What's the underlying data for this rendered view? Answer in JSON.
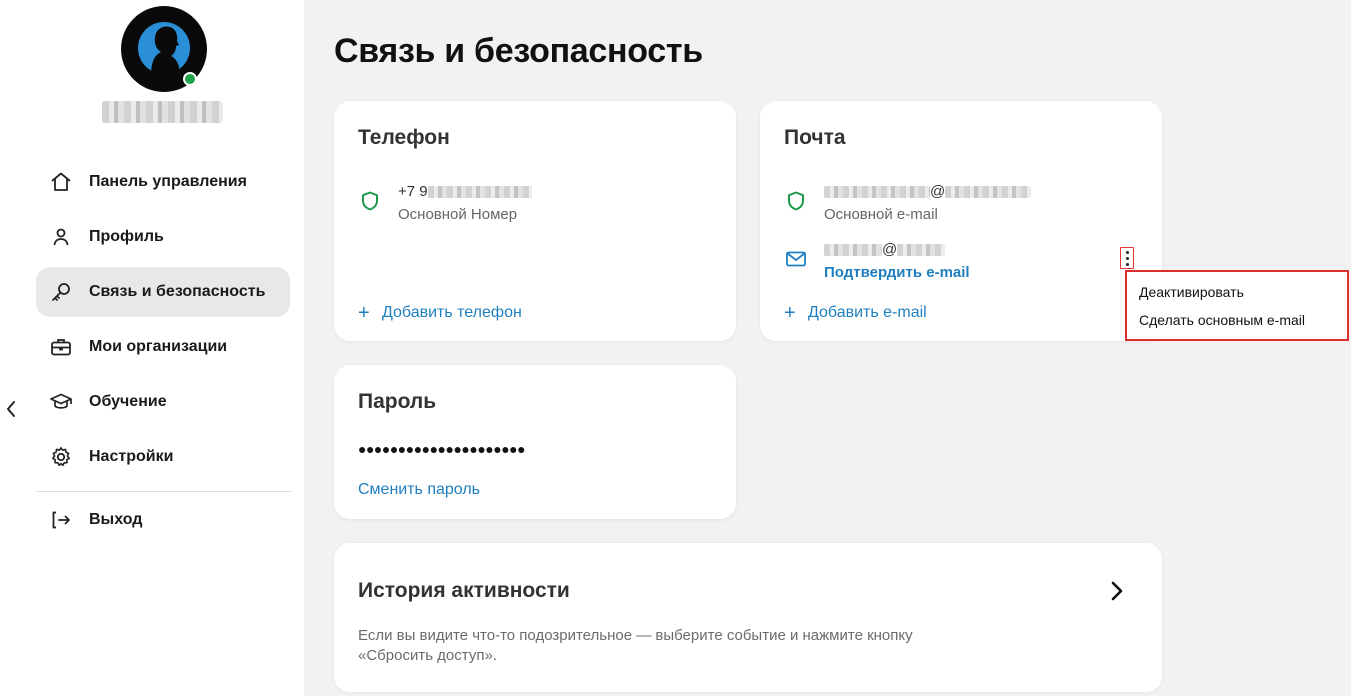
{
  "user": {
    "name_hidden": true
  },
  "sidebar": {
    "items": [
      {
        "label": "Панель управления",
        "icon": "home-icon"
      },
      {
        "label": "Профиль",
        "icon": "user-icon"
      },
      {
        "label": "Связь и безопасность",
        "icon": "key-icon",
        "active": true
      },
      {
        "label": "Мои организации",
        "icon": "briefcase-icon"
      },
      {
        "label": "Обучение",
        "icon": "graduation-cap-icon"
      },
      {
        "label": "Настройки",
        "icon": "gear-icon"
      }
    ],
    "logout_label": "Выход"
  },
  "page": {
    "title": "Связь и безопасность"
  },
  "phone_card": {
    "title": "Телефон",
    "number_prefix": "+7 9",
    "number_subtitle": "Основной Номер",
    "add_label": "Добавить телефон"
  },
  "email_card": {
    "title": "Почта",
    "primary_at": "@",
    "primary_subtitle": "Основной e-mail",
    "secondary_at": "@",
    "secondary_action": "Подтвердить e-mail",
    "add_label": "Добавить e-mail"
  },
  "email_menu": {
    "items": [
      {
        "label": "Деактивировать"
      },
      {
        "label": "Сделать основным e-mail"
      }
    ]
  },
  "password_card": {
    "title": "Пароль",
    "masked": "●●●●●●●●●●●●●●●●●●●●●",
    "change_label": "Сменить пароль"
  },
  "history_card": {
    "title": "История активности",
    "description": "Если вы видите что-то подозрительное — выберите событие и нажмите кнопку «Сбросить доступ»."
  },
  "colors": {
    "accent": "#1f7fc0",
    "shield": "#1f9a4a",
    "highlight": "#d9302f",
    "online": "#1fa34a"
  }
}
